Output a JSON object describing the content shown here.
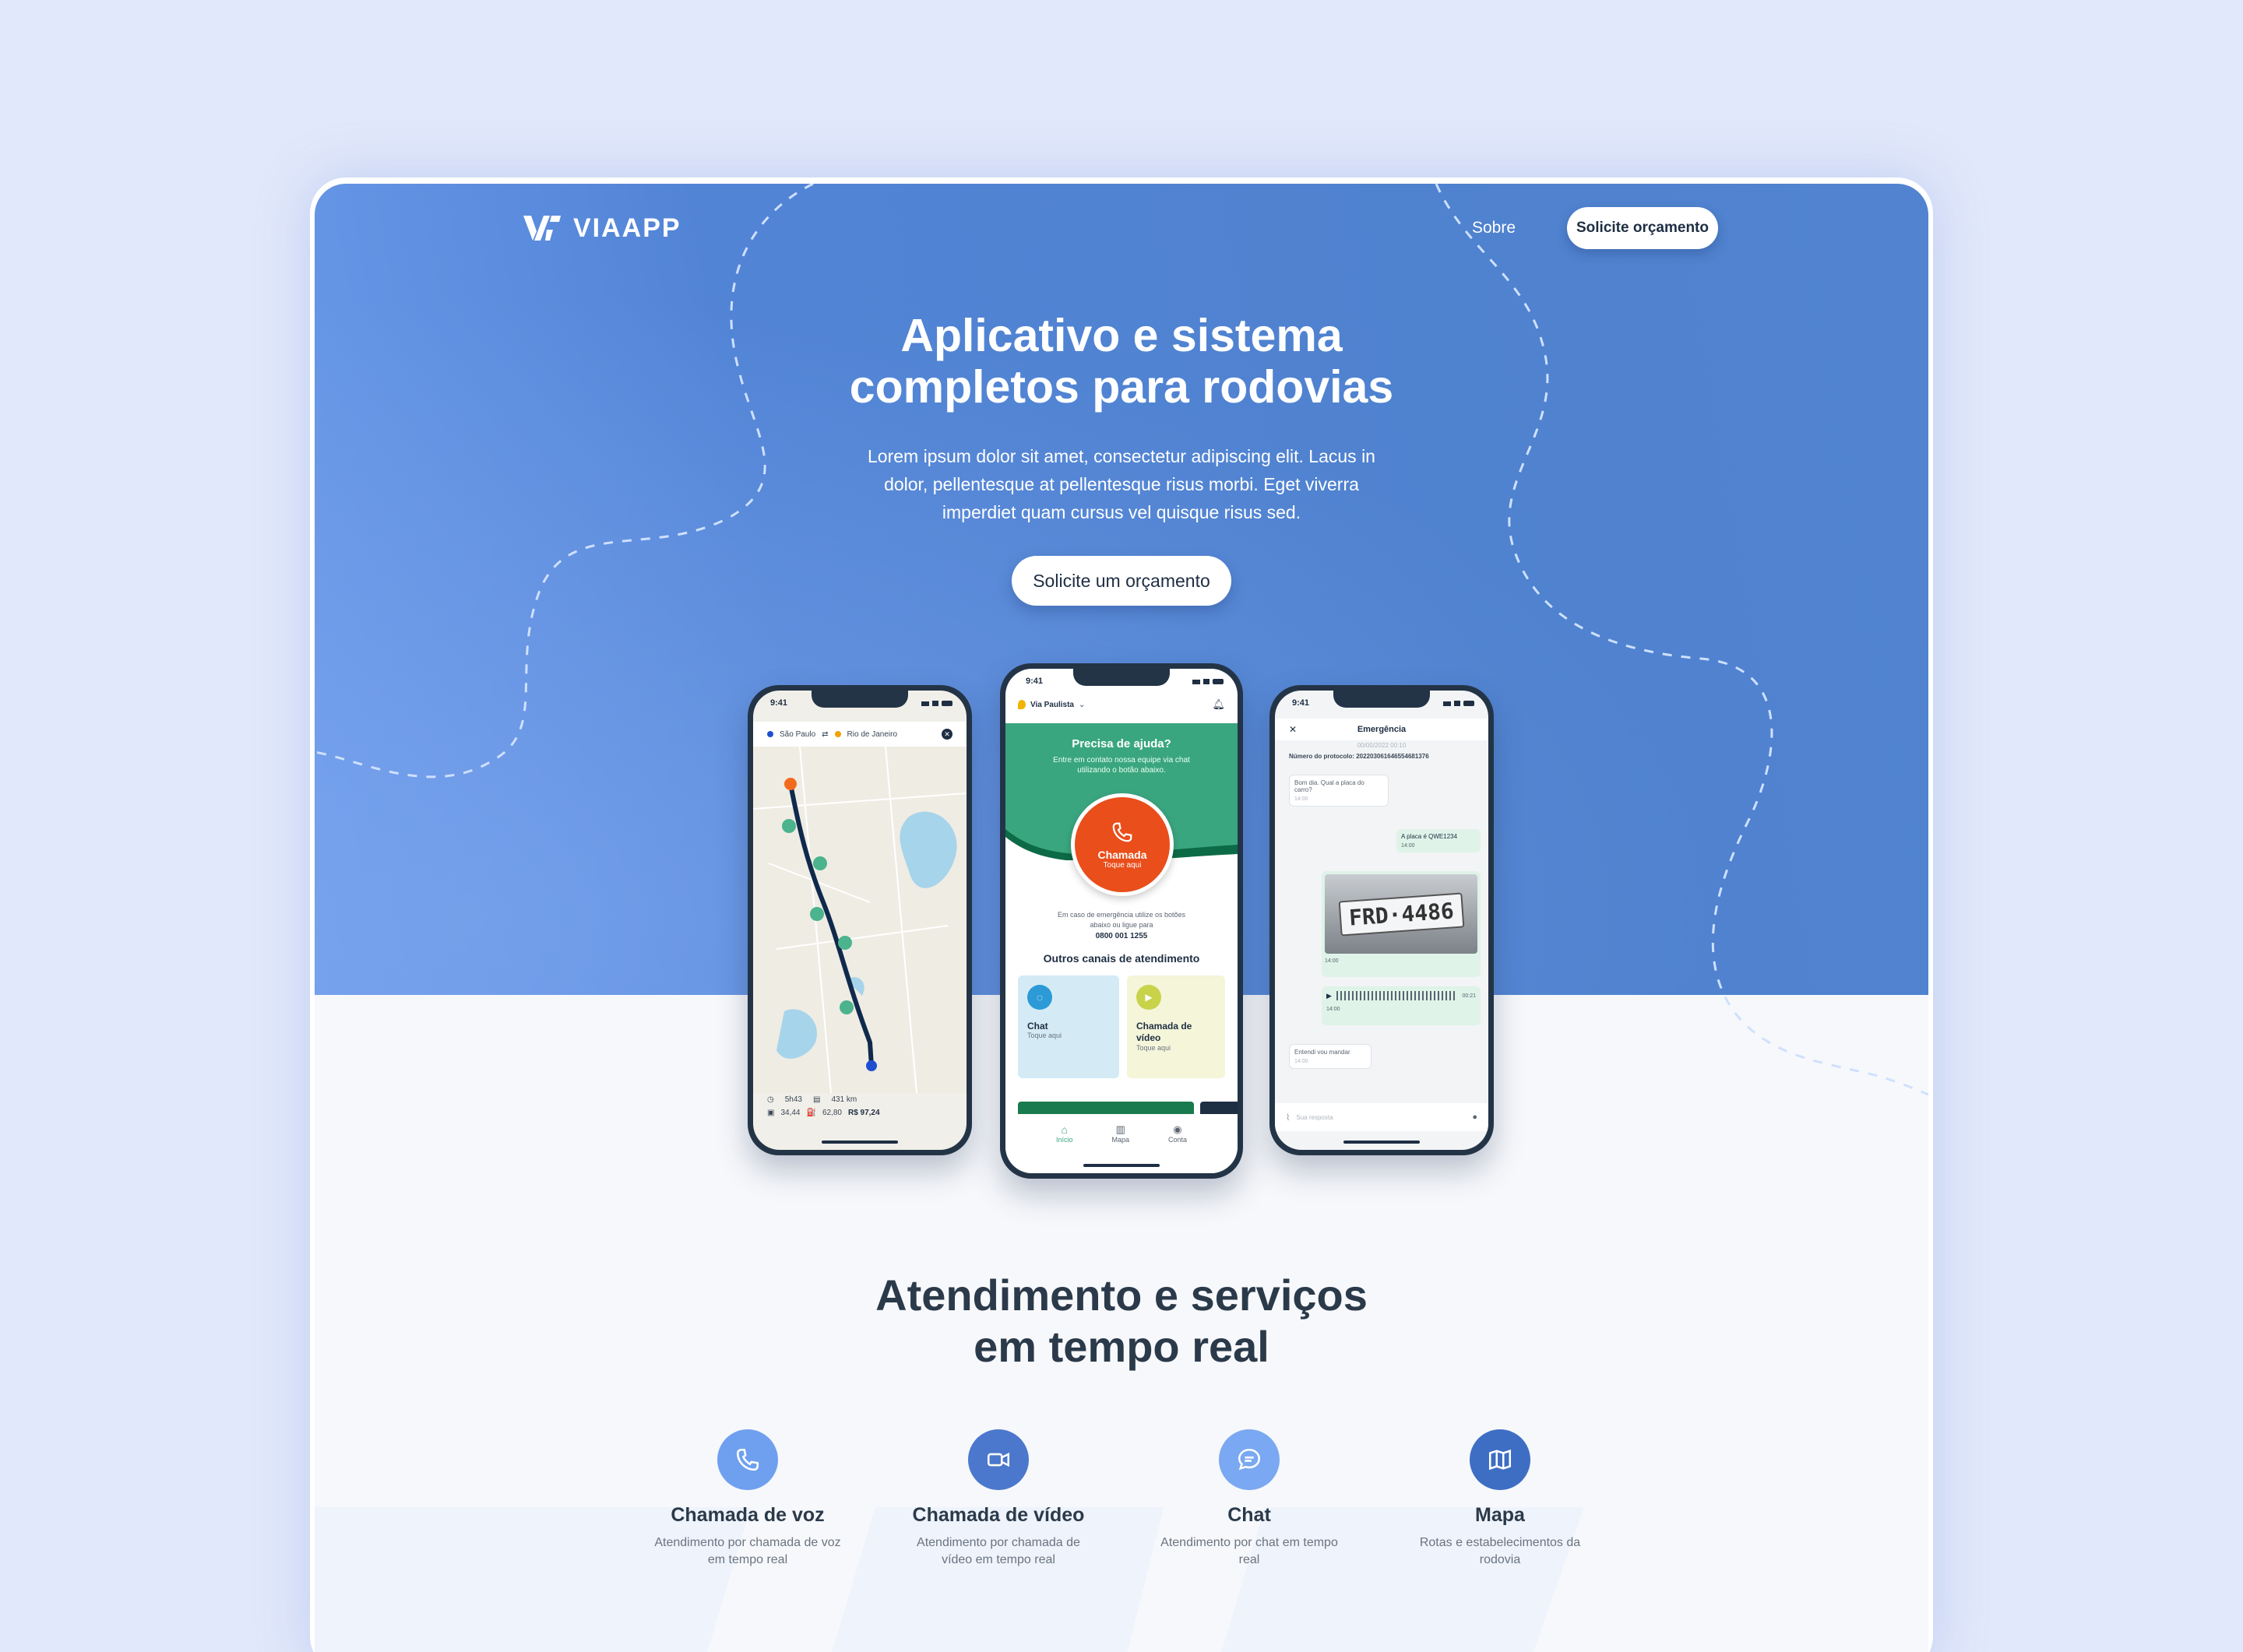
{
  "brand": {
    "logo_text": "VIAAPP"
  },
  "nav": {
    "about": "Sobre",
    "cta": "Solicite orçamento"
  },
  "hero": {
    "title": "Aplicativo e sistema\ncompletos para rodovias",
    "subtitle": "Lorem ipsum dolor sit amet, consectetur adipiscing elit. Lacus in dolor, pellentesque at pellentesque risus morbi. Eget viverra imperdiet quam cursus vel quisque risus sed.",
    "cta": "Solicite um orçamento"
  },
  "phone_map": {
    "time": "9:41",
    "origin": "São Paulo",
    "destination": "Rio de Janeiro",
    "duration": "5h43",
    "distance": "431 km",
    "toll": "34,44",
    "fuel": "62,80",
    "total": "R$ 97,24"
  },
  "phone_help": {
    "time": "9:41",
    "location": "Via Paulista",
    "help_title": "Precisa de ajuda?",
    "help_text": "Entre em contato nossa equipe via chat utilizando o botão abaixo.",
    "call_label": "Chamada",
    "call_sub": "Toque aqui",
    "emergency_text": "Em caso de emergência utilize os botões abaixo ou ligue para",
    "phone_number": "0800 001 1255",
    "other_channels": "Outros canais de atendimento",
    "chat_label": "Chat",
    "chat_sub": "Toque aqui",
    "video_label": "Chamada de vídeo",
    "video_sub": "Toque aqui",
    "tabs": [
      "Início",
      "Mapa",
      "Conta"
    ]
  },
  "phone_chat": {
    "time": "9:41",
    "title": "Emergência",
    "date": "00/00/2022 00:10",
    "protocol": "Número do protocolo: 20220306164655468137​6",
    "msg1": "Bom dia. Qual a placa do carro?",
    "msg1_time": "14:00",
    "msg2": "A placa é QWE1234",
    "msg2_time": "14:00",
    "plate": "FRD·4486",
    "img_time": "14:00",
    "audio_duration": "00:21",
    "audio_time": "14:00",
    "msg3": "Entendi vou mandar",
    "msg3_time": "14:00",
    "input_placeholder": "Sua resposta"
  },
  "services": {
    "title": "Atendimento e serviços\nem tempo real",
    "items": [
      {
        "title": "Chamada de voz",
        "desc": "Atendimento por chamada de voz em tempo real",
        "icon": "phone-icon",
        "color": "#6fa0ef"
      },
      {
        "title": "Chamada de vídeo",
        "desc": "Atendimento por chamada de vídeo em tempo real",
        "icon": "video-icon",
        "color": "#4b78cc"
      },
      {
        "title": "Chat",
        "desc": "Atendimento por chat em tempo real",
        "icon": "chat-icon",
        "color": "#7aa8f2"
      },
      {
        "title": "Mapa",
        "desc": "Rotas e estabelecimentos da rodovia",
        "icon": "map-icon",
        "color": "#3e6ec4"
      }
    ]
  },
  "colors": {
    "hero_blue": "#5284d6",
    "green": "#3aa67f",
    "orange": "#e94e1b",
    "text_dark": "#2b3a4a"
  }
}
